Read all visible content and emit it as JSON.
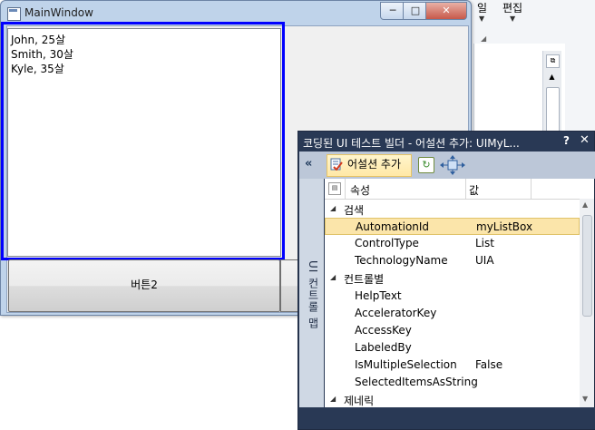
{
  "background": {
    "ribbon_label_1": "일",
    "ribbon_label_2": "편집",
    "dropdown_glyph": "▼",
    "scroll_up_glyph": "▲",
    "pane_glyph": "⧉"
  },
  "main_window": {
    "title": "MainWindow",
    "minimize_glyph": "─",
    "maximize_glyph": "□",
    "close_glyph": "✕",
    "list_items": [
      "John, 25살",
      "Smith, 30살",
      "Kyle, 35살"
    ],
    "button2_label": "버튼2",
    "highlight_color": "#0000ff"
  },
  "builder": {
    "title": "코딩된 UI 테스트 빌더 - 어설션 추가: UIMyL...",
    "help_label": "?",
    "close_label": "✕",
    "collapse_label": "«",
    "add_assertion_label": "어설션 추가",
    "side_tab_label": "UI 컨트롤 맵",
    "columns": {
      "property": "속성",
      "value": "값"
    },
    "rows": [
      {
        "type": "category",
        "label": "검색"
      },
      {
        "type": "prop",
        "label": "AutomationId",
        "value": "myListBox",
        "selected": true
      },
      {
        "type": "prop",
        "label": "ControlType",
        "value": "List"
      },
      {
        "type": "prop",
        "label": "TechnologyName",
        "value": "UIA"
      },
      {
        "type": "category",
        "label": "컨트롤별"
      },
      {
        "type": "prop",
        "label": "HelpText",
        "value": ""
      },
      {
        "type": "prop",
        "label": "AcceleratorKey",
        "value": ""
      },
      {
        "type": "prop",
        "label": "AccessKey",
        "value": ""
      },
      {
        "type": "prop",
        "label": "LabeledBy",
        "value": ""
      },
      {
        "type": "prop",
        "label": "IsMultipleSelection",
        "value": "False"
      },
      {
        "type": "prop",
        "label": "SelectedItemsAsString",
        "value": ""
      },
      {
        "type": "category",
        "label": "제네릭"
      }
    ],
    "accent_color": "#293955",
    "selection_color": "#fbe5aa"
  }
}
